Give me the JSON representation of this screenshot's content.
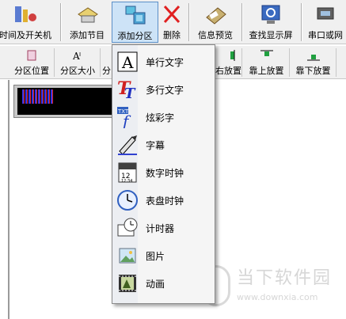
{
  "toolbar": {
    "buttons": [
      {
        "label": "时间及开关机",
        "icon": "clock-power-icon"
      },
      {
        "label": "添加节目",
        "icon": "add-program-icon"
      },
      {
        "label": "添加分区",
        "icon": "add-partition-icon"
      },
      {
        "label": "删除",
        "icon": "delete-icon"
      },
      {
        "label": "信息预览",
        "icon": "preview-icon"
      },
      {
        "label": "查找显示屏",
        "icon": "find-screen-icon"
      },
      {
        "label": "串口或网",
        "icon": "port-icon"
      }
    ]
  },
  "toolbar2": {
    "buttons": [
      {
        "label": "分区位置",
        "icon": "partition-position-icon"
      },
      {
        "label": "分区大小",
        "icon": "partition-size-icon"
      },
      {
        "label": "分",
        "icon": "align-icon"
      },
      {
        "label": "右放置",
        "icon": "align-right-icon"
      },
      {
        "label": "靠上放置",
        "icon": "align-top-icon"
      },
      {
        "label": "靠下放置",
        "icon": "align-bottom-icon"
      }
    ]
  },
  "menu": {
    "items": [
      {
        "label": "单行文字",
        "icon": "single-line-text-icon"
      },
      {
        "label": "多行文字",
        "icon": "multi-line-text-icon"
      },
      {
        "label": "炫彩字",
        "icon": "colorful-text-icon"
      },
      {
        "label": "字幕",
        "icon": "subtitle-icon"
      },
      {
        "label": "数字时钟",
        "icon": "digital-clock-icon"
      },
      {
        "label": "表盘时钟",
        "icon": "dial-clock-icon"
      },
      {
        "label": "计时器",
        "icon": "timer-icon"
      },
      {
        "label": "图片",
        "icon": "picture-icon"
      },
      {
        "label": "动画",
        "icon": "animation-icon"
      }
    ]
  },
  "watermark": {
    "title": "当下软件园",
    "url": "www.downxia.com"
  },
  "colors": {
    "active_bg": "#cde3f7",
    "active_border": "#5b8fc7",
    "led_bg": "#000000"
  }
}
